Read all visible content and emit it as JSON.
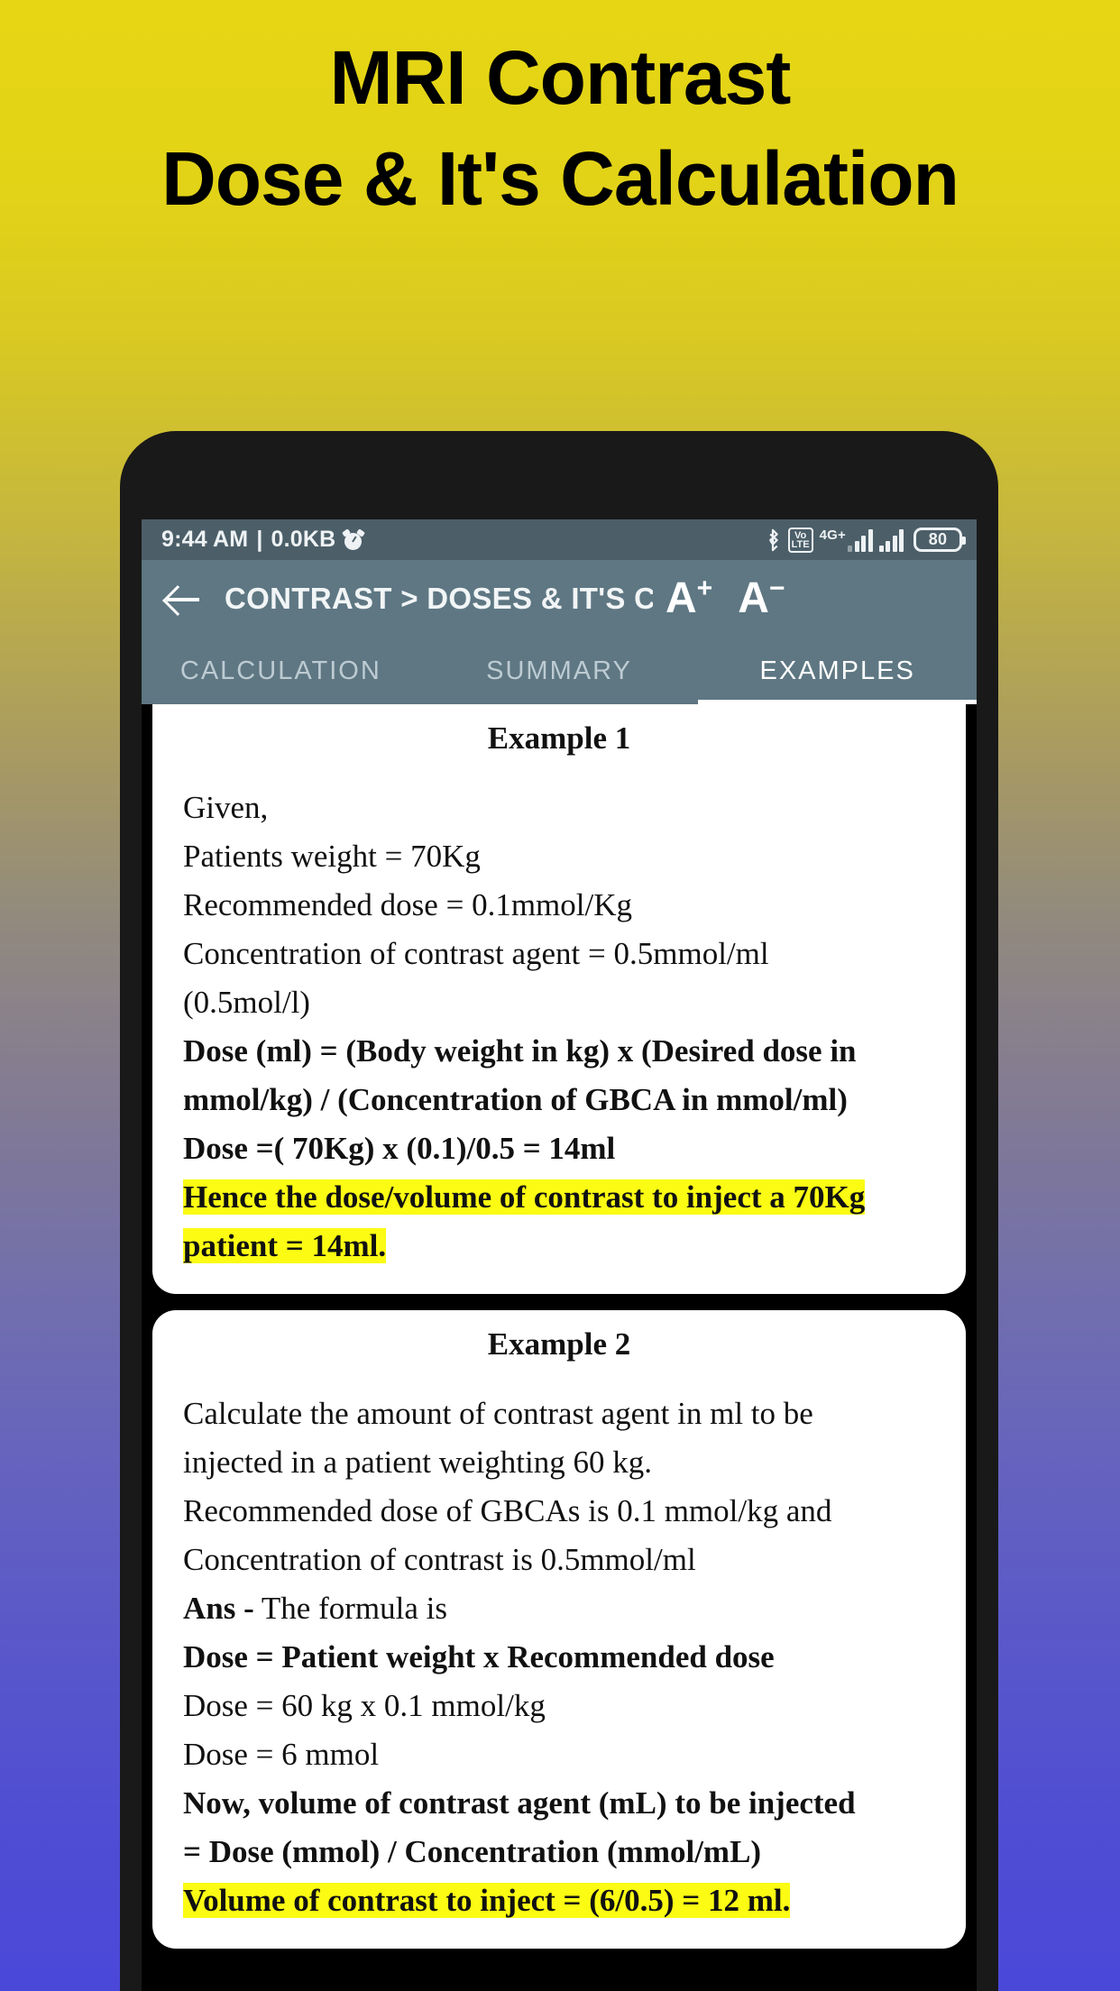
{
  "banner": {
    "line1": "MRI Contrast",
    "line2": "Dose & It's Calculation"
  },
  "colors": {
    "banner_background_top": "#e6d614",
    "background_bottom": "#4a48d8",
    "statusbar": "#4c5f69",
    "appbar": "#5e7783",
    "highlight": "#fbfb13",
    "phone_frame": "#191919"
  },
  "phone": {
    "statusbar": {
      "time": "9:44 AM",
      "separator": "|",
      "data_usage": "0.0KB",
      "alarm_icon": "alarm-clock-icon",
      "bluetooth_icon": "bluetooth-icon",
      "volte_label_top": "Vo",
      "volte_label_bottom": "LTE",
      "network_label": "4G+",
      "battery_level": "80"
    },
    "appbar": {
      "back_icon": "back-arrow-icon",
      "title": "CONTRAST > DOSES & IT'S CALCU",
      "font_increase": "A",
      "font_increase_sup": "+",
      "font_decrease": "A",
      "font_decrease_sup": "−"
    },
    "tabs": [
      {
        "label": "CALCULATION",
        "active": false
      },
      {
        "label": "SUMMARY",
        "active": false
      },
      {
        "label": "EXAMPLES",
        "active": true
      }
    ],
    "cards": [
      {
        "title": "Example 1",
        "lines": [
          {
            "text": "Given,",
            "bold": false,
            "highlight": false
          },
          {
            "text": "Patients weight = 70Kg",
            "bold": false,
            "highlight": false
          },
          {
            "text": "Recommended dose = 0.1mmol/Kg",
            "bold": false,
            "highlight": false
          },
          {
            "text": "Concentration of contrast agent = 0.5mmol/ml",
            "bold": false,
            "highlight": false
          },
          {
            "text": "(0.5mol/l)",
            "bold": false,
            "highlight": false
          },
          {
            "text": "Dose (ml) = (Body weight in kg) x (Desired dose in",
            "bold": true,
            "highlight": false
          },
          {
            "text": "mmol/kg) / (Concentration of GBCA in mmol/ml)",
            "bold": true,
            "highlight": false
          },
          {
            "text": "Dose =( 70Kg) x (0.1)/0.5 = 14ml",
            "bold": true,
            "highlight": false
          },
          {
            "text": "Hence the dose/volume of contrast to inject a 70Kg",
            "bold": true,
            "highlight": true
          },
          {
            "text": "patient = 14ml.",
            "bold": true,
            "highlight": true
          }
        ]
      },
      {
        "title": "Example 2",
        "lines": [
          {
            "text": "Calculate the amount of contrast agent in ml to be",
            "bold": false,
            "highlight": false
          },
          {
            "text": "injected in a patient weighting 60 kg.",
            "bold": false,
            "highlight": false
          },
          {
            "text": "Recommended dose of GBCAs is 0.1 mmol/kg and",
            "bold": false,
            "highlight": false
          },
          {
            "text": "Concentration of contrast is 0.5mmol/ml",
            "bold": false,
            "highlight": false
          },
          {
            "text": "Ans - The formula is",
            "bold": false,
            "highlight": false,
            "bold_prefix": "Ans -"
          },
          {
            "text": "Dose = Patient weight x Recommended dose",
            "bold": true,
            "highlight": false
          },
          {
            "text": "Dose = 60 kg x 0.1 mmol/kg",
            "bold": false,
            "highlight": false
          },
          {
            "text": "Dose = 6 mmol",
            "bold": false,
            "highlight": false
          },
          {
            "text": "Now, volume of contrast agent (mL) to be injected",
            "bold": true,
            "highlight": false
          },
          {
            "text": "= Dose (mmol) / Concentration (mmol/mL)",
            "bold": true,
            "highlight": false
          },
          {
            "text": "Volume of contrast to inject = (6/0.5) = 12 ml.",
            "bold": true,
            "highlight": true
          }
        ]
      }
    ]
  }
}
